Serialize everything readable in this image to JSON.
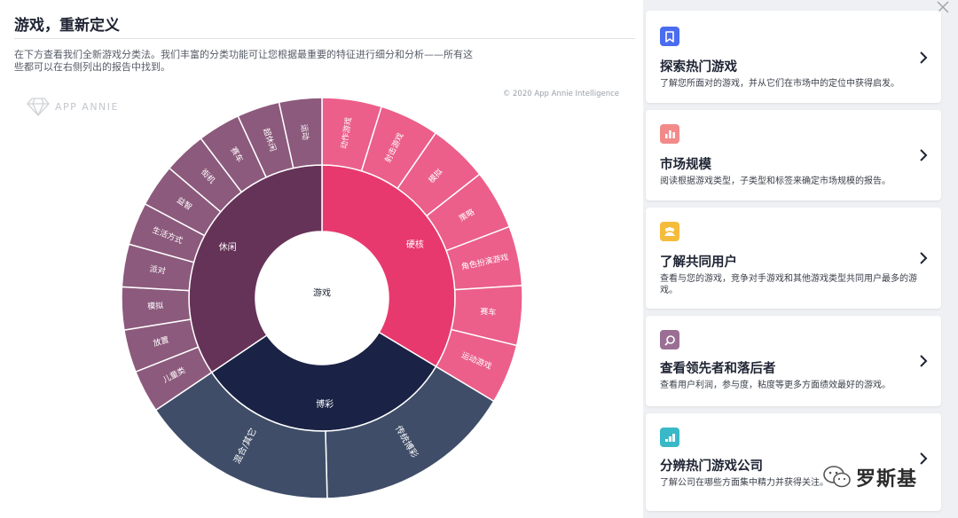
{
  "page": {
    "title": "游戏，重新定义",
    "intro": "在下方查看我们全新游戏分类法。我们丰富的分类功能可让您根据最重要的特征进行细分和分析——所有这些都可以在右侧列出的报告中找到。",
    "copyright": "© 2020 App Annie Intelligence",
    "logo_text": "APP ANNIE"
  },
  "chart_data": {
    "type": "sunburst",
    "center_label": "游戏",
    "colors": {
      "hardcore_inner": "#e8396f",
      "hardcore_outer": "#eb5f8a",
      "casual_inner": "#663358",
      "casual_outer": "#8c5a7c",
      "casino_inner": "#1a2345",
      "casino_outer": "#3f4d68"
    },
    "categories": [
      {
        "name": "硬核",
        "theme": "hardcore",
        "subcategories": [
          "动作游戏",
          "射击游戏",
          "模拟",
          "策略",
          "角色扮演游戏",
          "赛车",
          "运动游戏"
        ]
      },
      {
        "name": "博彩",
        "theme": "casino",
        "subcategories": [
          "传统博彩",
          "混合/其它"
        ]
      },
      {
        "name": "休闲",
        "theme": "casual",
        "subcategories": [
          "儿童类",
          "放置",
          "模拟",
          "派对",
          "生活方式",
          "益智",
          "街机",
          "赛车",
          "超休闲",
          "运动"
        ]
      }
    ]
  },
  "reports": [
    {
      "icon": "bookmark-icon",
      "color": "#4a6cf0",
      "title": "探索热门游戏",
      "desc": "了解您所面对的游戏，并从它们在市场中的定位中获得启发。"
    },
    {
      "icon": "bar-chart-icon",
      "color": "#f28a8a",
      "title": "市场规模",
      "desc": "阅读根据游戏类型，子类型和标签来确定市场规模的报告。"
    },
    {
      "icon": "users-icon",
      "color": "#f5bc3c",
      "title": "了解共同用户",
      "desc": "查看与您的游戏，竞争对手游戏和其他游戏类型共同用户最多的游戏。"
    },
    {
      "icon": "magnifier-icon",
      "color": "#9b6f94",
      "title": "查看领先者和落后者",
      "desc": "查看用户利润，参与度，粘度等更多方面绩效最好的游戏。"
    },
    {
      "icon": "growth-chart-icon",
      "color": "#39b8c8",
      "title": "分辨热门游戏公司",
      "desc": "了解公司在哪些方面集中精力并获得关注。"
    }
  ],
  "watermark": {
    "text": "罗斯基"
  }
}
